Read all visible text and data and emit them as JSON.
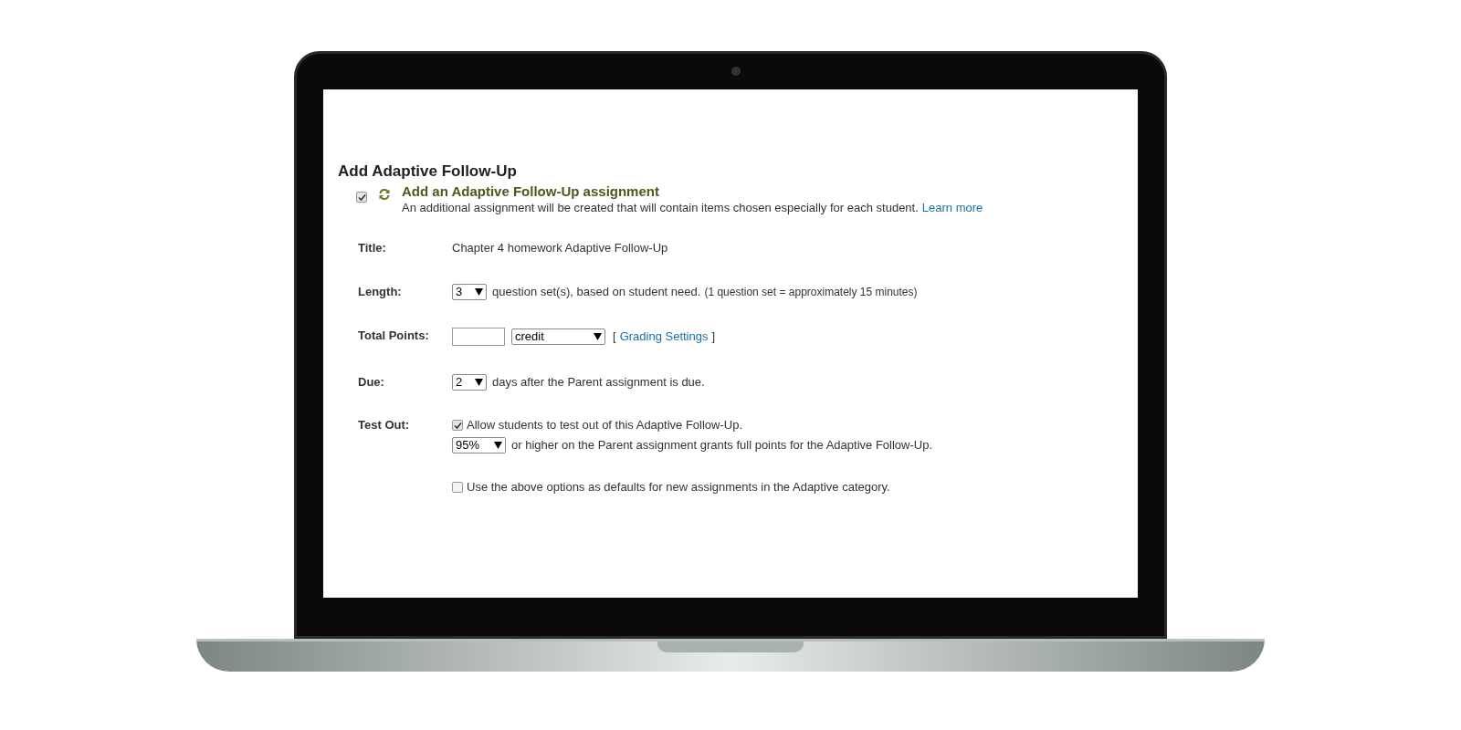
{
  "heading": "Add Adaptive Follow-Up",
  "enable": {
    "checked": true,
    "title": "Add an Adaptive Follow-Up assignment",
    "description": "An additional assignment will be created that will contain items chosen especially for each student.",
    "link": "Learn more"
  },
  "form": [
    {
      "kind": "text",
      "label": "Title:",
      "value": "Chapter 4 homework Adaptive Follow-Up"
    },
    {
      "kind": "select",
      "label": "Length:",
      "select": "3",
      "text": "question set(s), based on student need.",
      "note": "(1 question set = approximately 15 minutes)"
    },
    {
      "kind": "points",
      "label": "Total Points:",
      "select": "credit",
      "bracket_open": "[",
      "link": "Grading Settings",
      "bracket_close": "]"
    },
    {
      "kind": "select",
      "label": "Due:",
      "select": "2",
      "text": "days after the Parent assignment is due."
    },
    {
      "kind": "testout",
      "label": "Test Out:",
      "checked": true,
      "check_text": "Allow students to test out of this Adaptive Follow-Up.",
      "select": "95%",
      "text": "or higher on the Parent assignment grants full points for the Adaptive Follow-Up."
    }
  ],
  "defaults": {
    "checked": false,
    "text": "Use the above options as defaults for new assignments in the Adaptive category."
  }
}
